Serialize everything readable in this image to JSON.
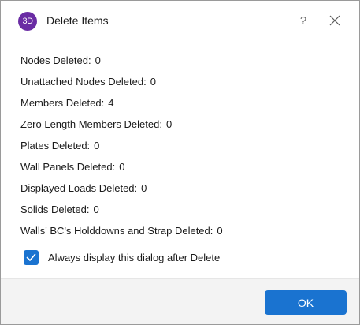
{
  "window": {
    "title": "Delete Items",
    "app_icon_text": "3D",
    "app_icon_color": "#6a2ca4",
    "help_label": "?",
    "close_icon": "close-icon"
  },
  "summary": {
    "items": [
      {
        "label": "Nodes Deleted:",
        "value": "0"
      },
      {
        "label": "Unattached Nodes Deleted:",
        "value": "0"
      },
      {
        "label": "Members Deleted:",
        "value": "4"
      },
      {
        "label": "Zero Length Members Deleted:",
        "value": "0"
      },
      {
        "label": "Plates Deleted:",
        "value": "0"
      },
      {
        "label": "Wall Panels Deleted:",
        "value": "0"
      },
      {
        "label": "Displayed Loads Deleted:",
        "value": "0"
      },
      {
        "label": "Solids Deleted:",
        "value": "0"
      },
      {
        "label": "Walls' BC's Holddowns and Strap Deleted:",
        "value": "0"
      }
    ]
  },
  "options": {
    "always_display_label": "Always display this dialog after Delete",
    "always_display_checked": true
  },
  "footer": {
    "ok_label": "OK",
    "accent_color": "#1a73d0"
  }
}
